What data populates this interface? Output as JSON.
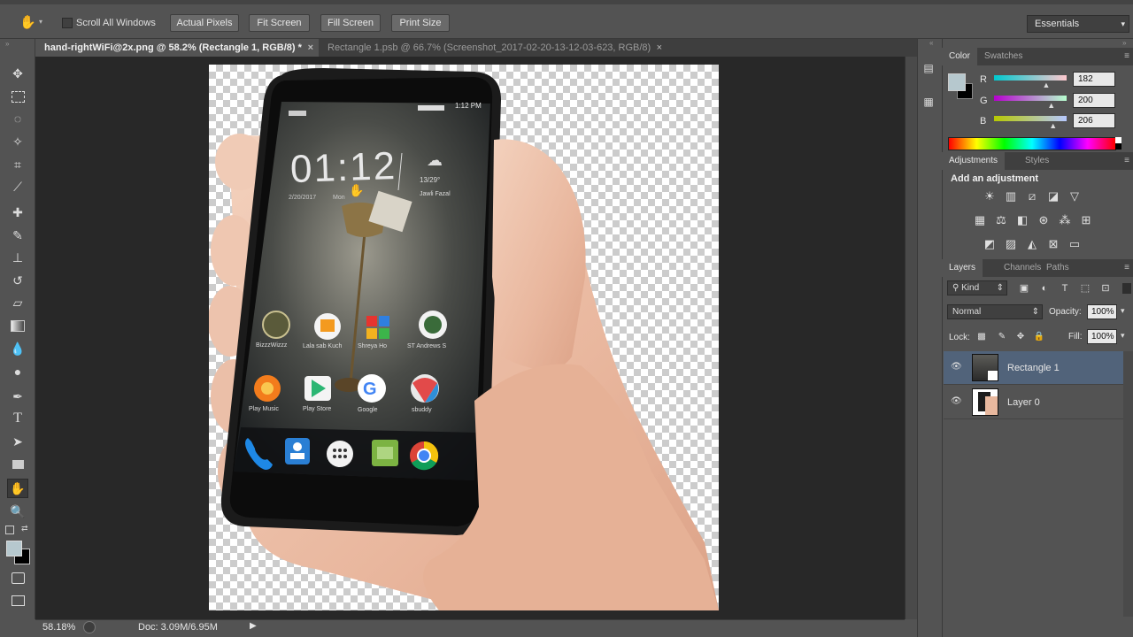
{
  "options_bar": {
    "scroll_all_label": "Scroll All Windows",
    "buttons": [
      "Actual Pixels",
      "Fit Screen",
      "Fill Screen",
      "Print Size"
    ],
    "workspace": "Essentials"
  },
  "tabs": [
    {
      "label": "hand-rightWiFi@2x.png @ 58.2% (Rectangle 1, RGB/8) *",
      "close": "×",
      "active": true
    },
    {
      "label": "Rectangle 1.psb @ 66.7% (Screenshot_2017-02-20-13-12-03-623, RGB/8)",
      "close": "×",
      "active": false
    }
  ],
  "status": {
    "zoom": "58.18%",
    "doc": "Doc: 3.09M/6.95M"
  },
  "color_panel": {
    "tabs": [
      "Color",
      "Swatches"
    ],
    "channels": [
      {
        "label": "R",
        "value": "182",
        "level": 0.714
      },
      {
        "label": "G",
        "value": "200",
        "level": 0.784
      },
      {
        "label": "B",
        "value": "206",
        "level": 0.808
      }
    ],
    "fg_color": "#b6c8ce",
    "bg_color": "#000000"
  },
  "adjustments_panel": {
    "tabs": [
      "Adjustments",
      "Styles"
    ],
    "heading": "Add an adjustment"
  },
  "layers_panel": {
    "tabs": [
      "Layers",
      "Channels",
      "Paths"
    ],
    "kind_label": "Kind",
    "blend_mode": "Normal",
    "opacity_label": "Opacity:",
    "opacity_value": "100%",
    "lock_label": "Lock:",
    "fill_label": "Fill:",
    "fill_value": "100%",
    "layers": [
      {
        "name": "Rectangle 1",
        "selected": true
      },
      {
        "name": "Layer 0",
        "selected": false
      }
    ]
  },
  "phone_screen": {
    "time": "01:12",
    "status_time": "1:12 PM",
    "date": "2/20/2017",
    "day": "Mon",
    "temperature": "13/29°",
    "location": "Jawli Fazal",
    "apps_row1": [
      "BizzzWizzz",
      "Lala sab Kuch",
      "Shreya Ho",
      "ST Andrews S"
    ],
    "apps_row2": [
      "Play Music",
      "Play Store",
      "Google",
      "sbuddy"
    ]
  }
}
